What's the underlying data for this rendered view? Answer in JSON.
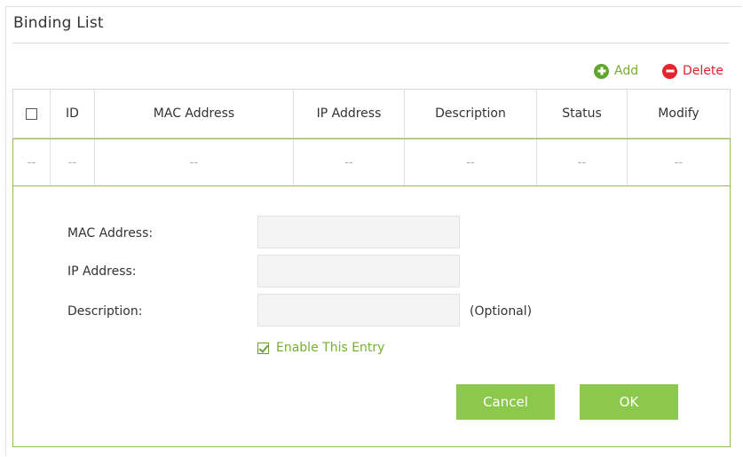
{
  "section": {
    "title": "Binding List"
  },
  "toolbar": {
    "add_label": "Add",
    "delete_label": "Delete"
  },
  "table": {
    "headers": [
      "ID",
      "MAC Address",
      "IP Address",
      "Description",
      "Status",
      "Modify"
    ],
    "rows": [
      [
        "--",
        "--",
        "--",
        "--",
        "--",
        "--",
        "--"
      ]
    ]
  },
  "form": {
    "mac_label": "MAC Address:",
    "mac_value": "",
    "ip_label": "IP Address:",
    "ip_value": "",
    "desc_label": "Description:",
    "desc_value": "",
    "desc_hint": "(Optional)",
    "enable_label": "Enable This Entry",
    "enable_checked": true,
    "cancel_label": "Cancel",
    "ok_label": "OK"
  },
  "colors": {
    "accent_green": "#8cc84b",
    "add_green": "#5fa62a",
    "delete_red": "#e3262e"
  },
  "icons": {
    "add": "plus-circle-icon",
    "delete": "minus-circle-icon",
    "enable": "checkbox-checked-icon"
  }
}
